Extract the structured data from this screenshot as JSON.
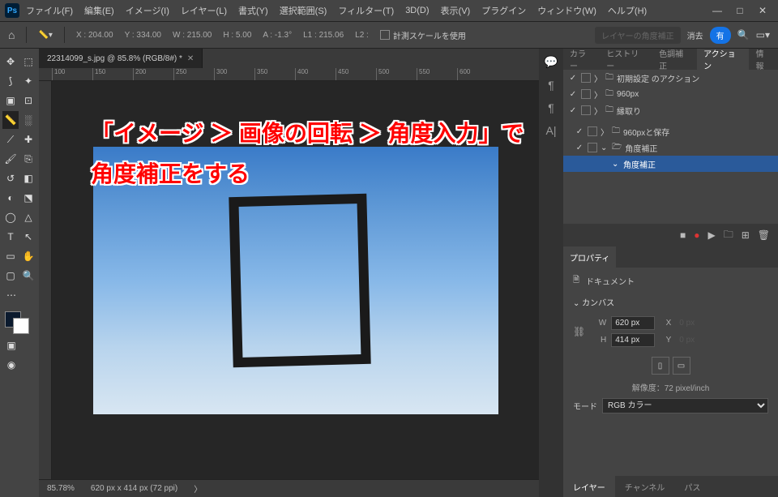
{
  "app": {
    "logo": "Ps"
  },
  "menu": {
    "file": "ファイル(F)",
    "edit": "編集(E)",
    "image": "イメージ(I)",
    "layer": "レイヤー(L)",
    "type": "書式(Y)",
    "select": "選択範囲(S)",
    "filter": "フィルター(T)",
    "threed": "3D(D)",
    "view": "表示(V)",
    "plugin": "プラグイン",
    "window": "ウィンドウ(W)",
    "help": "ヘルプ(H)"
  },
  "win_btns": {
    "min": "—",
    "max": "□",
    "close": "✕"
  },
  "optbar": {
    "x_lbl": "X :",
    "x": "204.00",
    "y_lbl": "Y :",
    "y": "334.00",
    "w_lbl": "W :",
    "w": "215.00",
    "h_lbl": "H :",
    "h": "5.00",
    "a_lbl": "A :",
    "a": "-1.3°",
    "l1_lbl": "L1 :",
    "l1": "215.06",
    "l2_lbl": "L2 :",
    "l2": "",
    "use_scale": "計測スケールを使用",
    "straighten": "レイヤーの角度補正",
    "clear": "消去",
    "blue": "有"
  },
  "doc": {
    "title": "22314099_s.jpg @ 85.8% (RGB/8#) *"
  },
  "ruler_h": [
    "100",
    "150",
    "200",
    "250",
    "300",
    "350",
    "400",
    "450",
    "500",
    "550",
    "600"
  ],
  "status": {
    "zoom": "85.78%",
    "dims": "620 px x 414 px (72 ppi)"
  },
  "panel_tabs": {
    "color": "カラー",
    "history": "ヒストリー",
    "adjust": "色調補正",
    "actions": "アクション",
    "info": "情報"
  },
  "actions": {
    "default_set": "初期設定 のアクション",
    "s960": "960px",
    "border": "縁取り",
    "s960save": "960pxと保存",
    "angle_set": "角度補正",
    "angle_action": "角度補正"
  },
  "props": {
    "title": "プロパティ",
    "doc": "ドキュメント",
    "canvas": "カンバス",
    "w_lbl": "W",
    "w": "620 px",
    "h_lbl": "H",
    "h": "414 px",
    "x_lbl": "X",
    "x": "0 px",
    "y_lbl": "Y",
    "y": "0 px",
    "res": "解像度：72 pixel/inch",
    "mode_lbl": "モード",
    "mode": "RGB カラー"
  },
  "bottom_tabs": {
    "layers": "レイヤー",
    "channels": "チャンネル",
    "paths": "パス"
  },
  "overlay": {
    "l1": "「イメージ ＞ 画像の回転 ＞ 角度入力」で",
    "l2": "角度補正をする"
  },
  "tool_icons": {
    "move": "✥",
    "marquee": "⬚",
    "lasso": "⟆",
    "wand": "✦",
    "crop": "▣",
    "frame": "⊡",
    "ruler": "📏",
    "dotsel": "░",
    "eyedrop": "⟋",
    "heal": "✚",
    "brush": "🖌",
    "stamp": "⎘",
    "history": "↺",
    "eraser": "◧",
    "gradient": "◐",
    "blur": "⬔",
    "dodge": "◯",
    "sharpen": "△",
    "pen": "T",
    "arrow": "↖",
    "rect": "▭",
    "hand": "✋",
    "shape": "▢",
    "zoom": "🔍",
    "edit": "⋯",
    "eye": "◉"
  }
}
